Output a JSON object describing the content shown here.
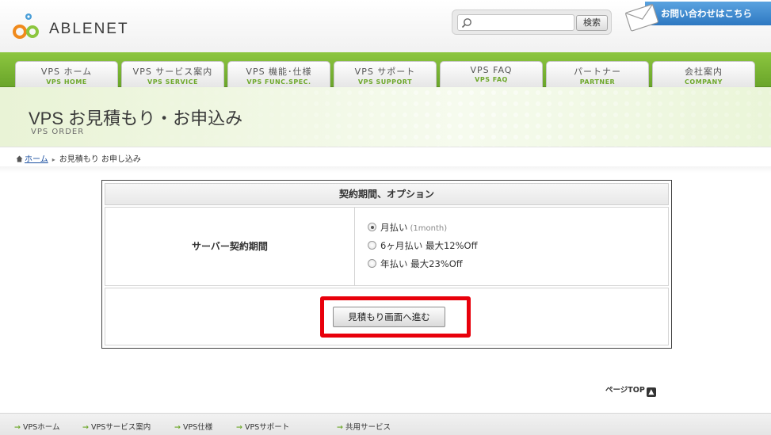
{
  "header": {
    "logo_text": "ABLENET",
    "search": {
      "placeholder": "",
      "button_label": "検索"
    },
    "contact_label": "お問い合わせはこちら"
  },
  "nav": {
    "tabs": [
      {
        "jp": "VPS ホーム",
        "en": "VPS HOME"
      },
      {
        "jp": "VPS サービス案内",
        "en": "VPS SERVICE"
      },
      {
        "jp": "VPS 機能･仕様",
        "en": "VPS FUNC.SPEC."
      },
      {
        "jp": "VPS サポート",
        "en": "VPS SUPPORT"
      },
      {
        "jp": "VPS FAQ",
        "en": "VPS FAQ"
      },
      {
        "jp": "パートナー",
        "en": "PARTNER"
      },
      {
        "jp": "会社案内",
        "en": "COMPANY"
      }
    ]
  },
  "title_band": {
    "title": "VPS お見積もり・お申込み",
    "subtitle": "VPS ORDER"
  },
  "breadcrumb": {
    "home": "ホーム",
    "current": "お見積もり お申し込み"
  },
  "form": {
    "heading": "契約期間、オプション",
    "row_label": "サーバー契約期間",
    "options": [
      {
        "label": "月払い",
        "note": "(1month)",
        "checked": true
      },
      {
        "label": "6ヶ月払い 最大12%Off",
        "note": "",
        "checked": false
      },
      {
        "label": "年払い 最大23%Off",
        "note": "",
        "checked": false
      }
    ],
    "submit_label": "見積もり画面へ進む",
    "highlight_color": "#e8000b"
  },
  "page_top_label": "ページTOP",
  "footer": {
    "links": [
      "VPSホーム",
      "VPSサービス案内",
      "VPS仕様",
      "VPSサポート",
      "共用サービス"
    ]
  },
  "colors": {
    "nav_green": "#7bb934",
    "contact_blue": "#3a86cf",
    "link_blue": "#1a4fa0"
  }
}
